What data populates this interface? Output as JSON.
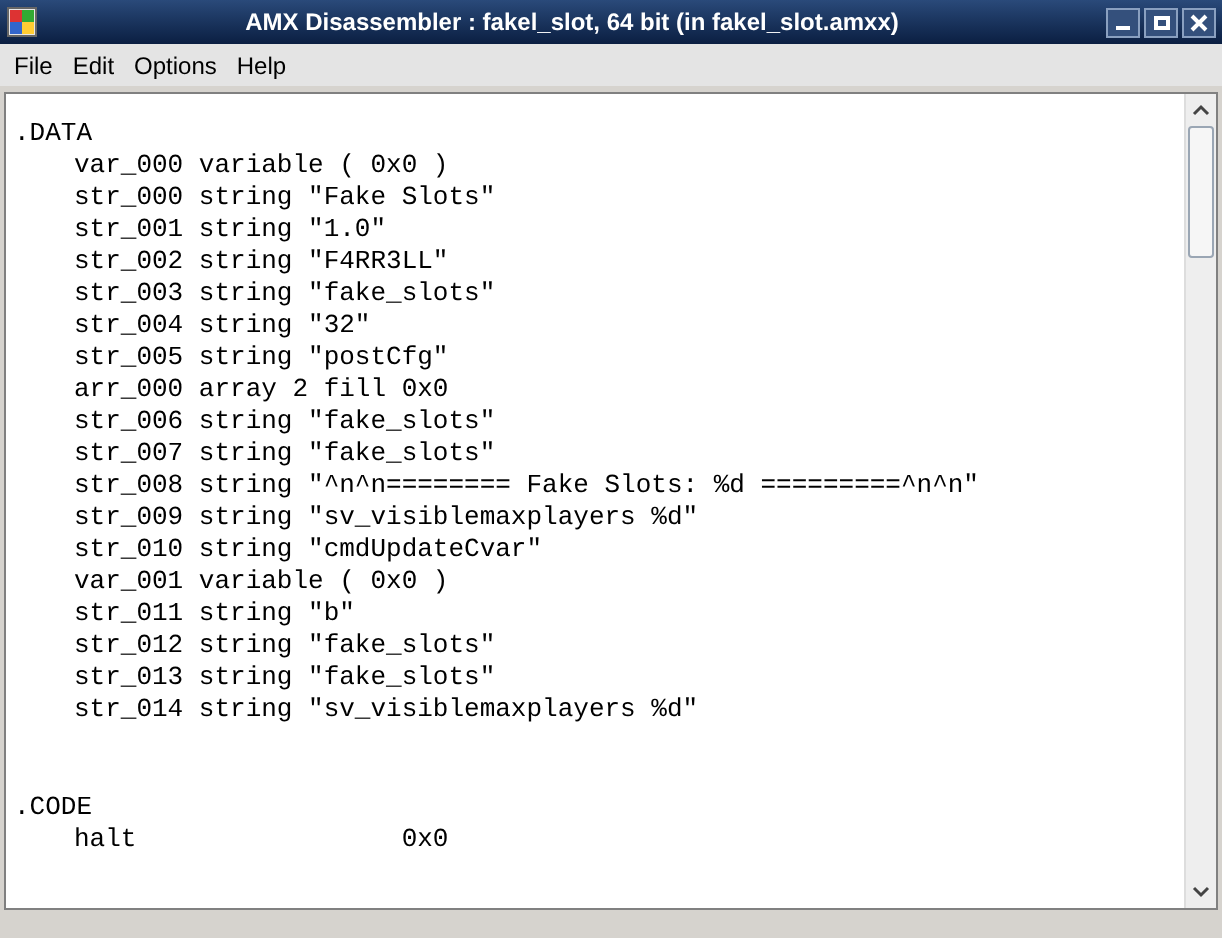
{
  "window": {
    "title": "AMX Disassembler : fakel_slot, 64 bit (in fakel_slot.amxx)"
  },
  "menu": [
    "File",
    "Edit",
    "Options",
    "Help"
  ],
  "listing": [
    {
      "kind": "section",
      "text": ".DATA"
    },
    {
      "kind": "entry",
      "text": "var_000 variable ( 0x0 )"
    },
    {
      "kind": "entry",
      "text": "str_000 string \"Fake Slots\""
    },
    {
      "kind": "entry",
      "text": "str_001 string \"1.0\""
    },
    {
      "kind": "entry",
      "text": "str_002 string \"F4RR3LL\""
    },
    {
      "kind": "entry",
      "text": "str_003 string \"fake_slots\""
    },
    {
      "kind": "entry",
      "text": "str_004 string \"32\""
    },
    {
      "kind": "entry",
      "text": "str_005 string \"postCfg\""
    },
    {
      "kind": "entry",
      "text": "arr_000 array 2 fill 0x0"
    },
    {
      "kind": "entry",
      "text": "str_006 string \"fake_slots\""
    },
    {
      "kind": "entry",
      "text": "str_007 string \"fake_slots\""
    },
    {
      "kind": "entry",
      "text": "str_008 string \"^n^n======== Fake Slots: %d =========^n^n\""
    },
    {
      "kind": "entry",
      "text": "str_009 string \"sv_visiblemaxplayers %d\""
    },
    {
      "kind": "entry",
      "text": "str_010 string \"cmdUpdateCvar\""
    },
    {
      "kind": "entry",
      "text": "var_001 variable ( 0x0 )"
    },
    {
      "kind": "entry",
      "text": "str_011 string \"b\""
    },
    {
      "kind": "entry",
      "text": "str_012 string \"fake_slots\""
    },
    {
      "kind": "entry",
      "text": "str_013 string \"fake_slots\""
    },
    {
      "kind": "entry",
      "text": "str_014 string \"sv_visiblemaxplayers %d\""
    },
    {
      "kind": "section",
      "text": ".CODE"
    },
    {
      "kind": "entry",
      "text": "halt                 0x0"
    }
  ]
}
